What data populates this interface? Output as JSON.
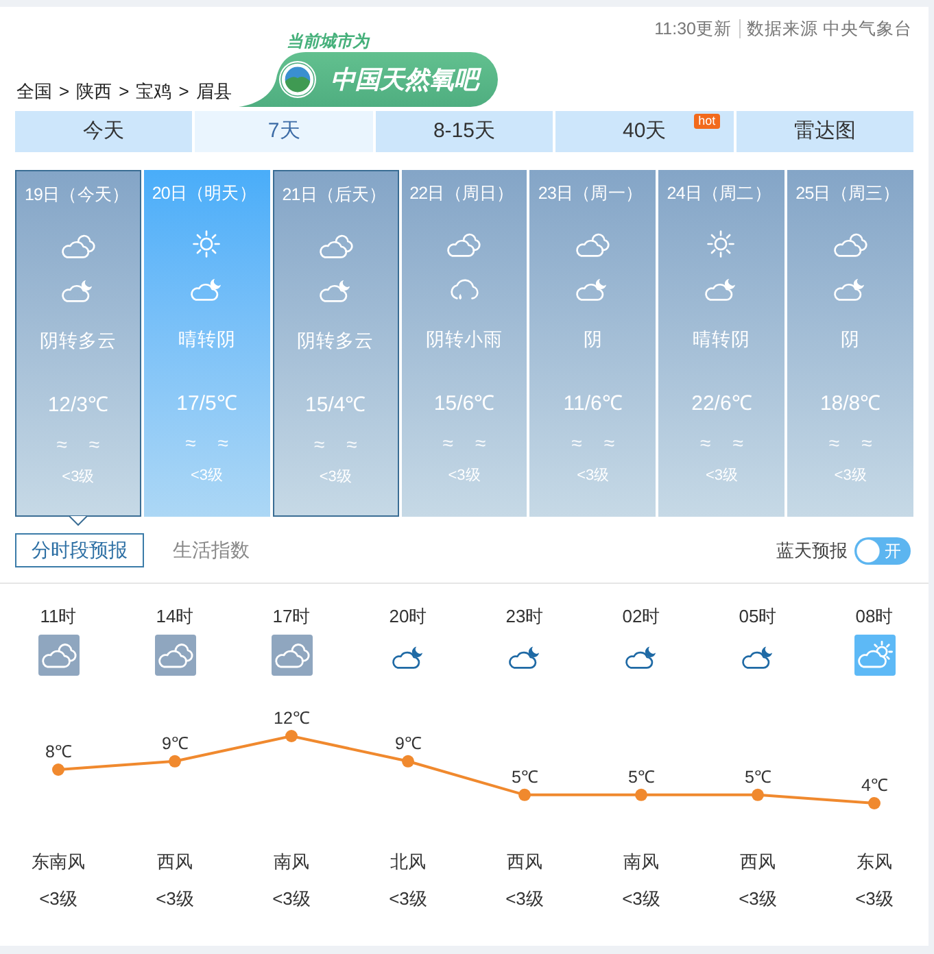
{
  "header": {
    "update_time": "11:30更新",
    "source": "数据来源 中央气象台"
  },
  "logo": {
    "caption": "当前城市为",
    "name": "中国天然氧吧"
  },
  "breadcrumb": [
    {
      "text": "全国",
      "separator": ">"
    },
    {
      "text": "陕西",
      "separator": ">"
    },
    {
      "text": "宝鸡",
      "separator": ">"
    },
    {
      "text": "眉县"
    }
  ],
  "tabs": [
    {
      "label": "今天",
      "selected": false
    },
    {
      "label": "7天",
      "selected": true
    },
    {
      "label": "8-15天",
      "selected": false
    },
    {
      "label": "40天",
      "selected": false,
      "badge": "hot"
    },
    {
      "label": "雷达图",
      "selected": false
    }
  ],
  "days": [
    {
      "date": "19日（今天）",
      "icons": [
        {
          "kind": "overcast"
        },
        {
          "kind": "partly-cloudy-night"
        }
      ],
      "weather": "阴转多云",
      "temperature": "12/3℃",
      "wind_symbols": [
        "≈",
        "≈"
      ],
      "wind_level": "<3级",
      "selected": true,
      "outlined": true,
      "highlighted": false
    },
    {
      "date": "20日（明天）",
      "icons": [
        {
          "kind": "sunny"
        },
        {
          "kind": "partly-cloudy-night"
        }
      ],
      "weather": "晴转阴",
      "temperature": "17/5℃",
      "wind_symbols": [
        "≈",
        "≈"
      ],
      "wind_level": "<3级",
      "selected": false,
      "outlined": false,
      "highlighted": true
    },
    {
      "date": "21日（后天）",
      "icons": [
        {
          "kind": "overcast"
        },
        {
          "kind": "partly-cloudy-night"
        }
      ],
      "weather": "阴转多云",
      "temperature": "15/4℃",
      "wind_symbols": [
        "≈",
        "≈"
      ],
      "wind_level": "<3级",
      "selected": false,
      "outlined": true,
      "highlighted": false
    },
    {
      "date": "22日（周日）",
      "icons": [
        {
          "kind": "overcast"
        },
        {
          "kind": "rain"
        }
      ],
      "weather": "阴转小雨",
      "temperature": "15/6℃",
      "wind_symbols": [
        "≈",
        "≈"
      ],
      "wind_level": "<3级",
      "selected": false,
      "outlined": false,
      "highlighted": false
    },
    {
      "date": "23日（周一）",
      "icons": [
        {
          "kind": "overcast"
        },
        {
          "kind": "partly-cloudy-night"
        }
      ],
      "weather": "阴",
      "temperature": "11/6℃",
      "wind_symbols": [
        "≈",
        "≈"
      ],
      "wind_level": "<3级",
      "selected": false,
      "outlined": false,
      "highlighted": false
    },
    {
      "date": "24日（周二）",
      "icons": [
        {
          "kind": "sunny"
        },
        {
          "kind": "partly-cloudy-night"
        }
      ],
      "weather": "晴转阴",
      "temperature": "22/6℃",
      "wind_symbols": [
        "≈",
        "≈"
      ],
      "wind_level": "<3级",
      "selected": false,
      "outlined": false,
      "highlighted": false
    },
    {
      "date": "25日（周三）",
      "icons": [
        {
          "kind": "overcast"
        },
        {
          "kind": "partly-cloudy-night"
        }
      ],
      "weather": "阴",
      "temperature": "18/8℃",
      "wind_symbols": [
        "≈",
        "≈"
      ],
      "wind_level": "<3级",
      "selected": false,
      "outlined": false,
      "highlighted": false
    }
  ],
  "sub_tabs": [
    {
      "label": "分时段预报",
      "selected": true
    },
    {
      "label": "生活指数",
      "selected": false
    }
  ],
  "blue_sky_forecast": {
    "label": "蓝天预报",
    "on": true,
    "state_text": "开"
  },
  "hourly": {
    "hours": [
      {
        "time": "11时",
        "kind": "overcast",
        "wind": "东南风",
        "wind_level": "<3级"
      },
      {
        "time": "14时",
        "kind": "overcast",
        "wind": "西风",
        "wind_level": "<3级"
      },
      {
        "time": "17时",
        "kind": "overcast",
        "wind": "南风",
        "wind_level": "<3级"
      },
      {
        "time": "20时",
        "kind": "partly-cloudy-night",
        "wind": "北风",
        "wind_level": "<3级"
      },
      {
        "time": "23时",
        "kind": "partly-cloudy-night",
        "wind": "西风",
        "wind_level": "<3级"
      },
      {
        "time": "02时",
        "kind": "partly-cloudy-night",
        "wind": "南风",
        "wind_level": "<3级"
      },
      {
        "time": "05时",
        "kind": "partly-cloudy-night",
        "wind": "西风",
        "wind_level": "<3级"
      },
      {
        "time": "08时",
        "kind": "partly-cloudy-day",
        "wind": "东风",
        "wind_level": "<3级"
      }
    ],
    "temperature_unit": "℃",
    "chart_data": {
      "type": "line",
      "series": [
        {
          "color": "#f0892e",
          "marker": "circle",
          "values": [
            8,
            9,
            12,
            9,
            5,
            5,
            5,
            4
          ]
        }
      ],
      "data_labels": true
    }
  }
}
